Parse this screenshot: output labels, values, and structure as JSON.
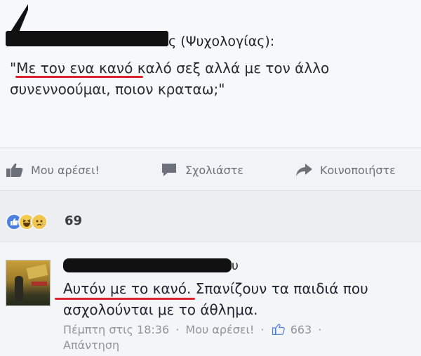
{
  "post": {
    "author_suffix": "ς (Ψυχολογίας):",
    "text": "\"Με τον ενα κανό καλό σεξ αλλά με τον άλλο συνεννοούμαι, ποιον κραταω;\"",
    "highlight_color": "#d8242a"
  },
  "actions": {
    "like_label": "Μου αρέσει!",
    "like_icon": "thumbs-up-icon",
    "comment_label": "Σχολιάστε",
    "comment_icon": "speech-bubble-icon",
    "share_label": "Κοινοποιήστε",
    "share_icon": "share-arrow-icon"
  },
  "reactions": {
    "icons": [
      "like-reaction-icon",
      "haha-reaction-icon",
      "sad-reaction-icon"
    ],
    "count": "69"
  },
  "comment": {
    "name_suffix": "υ",
    "text": "Αυτόν με το κανό. Σπανίζουν τα παιδιά που ασχολούνται με το άθλημα.",
    "timestamp": "Πέμπτη στις 18:36",
    "like_link": "Μου αρέσει!",
    "like_count": "663",
    "reply_link": "Απάντηση",
    "separator": "·"
  }
}
